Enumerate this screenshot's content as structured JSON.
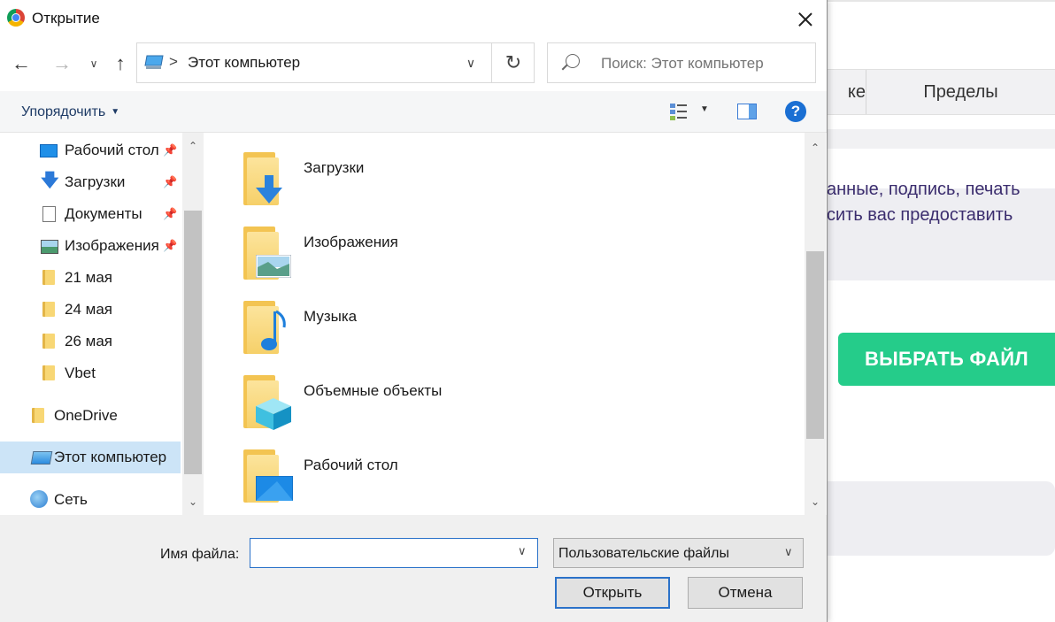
{
  "background_page": {
    "tab_partial": "ке",
    "tab_limits": "Пределы",
    "text_line1": "анные, подпись, печать",
    "text_line2": "сить вас предоставить",
    "button_choose_file": "ВЫБРАТЬ ФАЙЛ",
    "accent_color": "#25cc8a"
  },
  "dialog": {
    "title": "Открытие",
    "address": {
      "separator": ">",
      "location": "Этот компьютер"
    },
    "search": {
      "placeholder": "Поиск: Этот компьютер"
    },
    "toolbar": {
      "organize_label": "Упорядочить",
      "help_label": "?"
    },
    "nav_pane": {
      "items": [
        {
          "label": "Рабочий стол",
          "icon": "desktop-icon",
          "pinned": true
        },
        {
          "label": "Загрузки",
          "icon": "download-icon",
          "pinned": true
        },
        {
          "label": "Документы",
          "icon": "document-icon",
          "pinned": true
        },
        {
          "label": "Изображения",
          "icon": "pictures-icon",
          "pinned": true
        },
        {
          "label": "21 мая",
          "icon": "folder-icon",
          "pinned": false
        },
        {
          "label": "24 мая",
          "icon": "folder-icon",
          "pinned": false
        },
        {
          "label": "26 мая",
          "icon": "folder-icon",
          "pinned": false
        },
        {
          "label": "Vbet",
          "icon": "folder-icon",
          "pinned": false
        },
        {
          "label": "OneDrive",
          "icon": "folder-icon",
          "pinned": false
        },
        {
          "label": "Этот компьютер",
          "icon": "computer-icon",
          "pinned": false,
          "selected": true
        },
        {
          "label": "Сеть",
          "icon": "network-icon",
          "pinned": false
        }
      ]
    },
    "content": {
      "items": [
        {
          "label": "Загрузки",
          "icon": "downloads-folder-icon"
        },
        {
          "label": "Изображения",
          "icon": "pictures-folder-icon"
        },
        {
          "label": "Музыка",
          "icon": "music-folder-icon"
        },
        {
          "label": "Объемные объекты",
          "icon": "3d-objects-folder-icon"
        },
        {
          "label": "Рабочий стол",
          "icon": "desktop-folder-icon"
        }
      ]
    },
    "bottom": {
      "filename_label": "Имя файла:",
      "filename_value": "",
      "filetype_selected": "Пользовательские файлы",
      "open_label": "Открыть",
      "cancel_label": "Отмена"
    }
  }
}
